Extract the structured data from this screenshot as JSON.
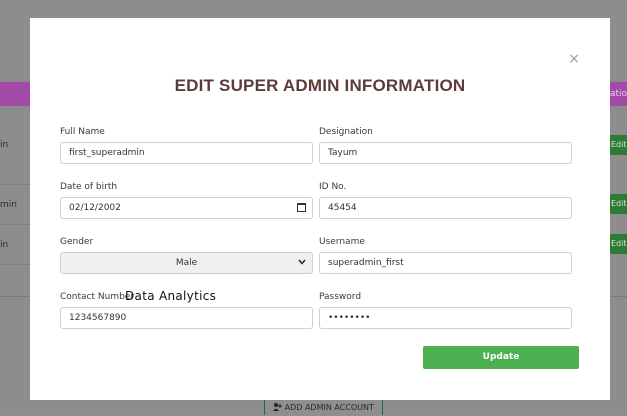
{
  "background": {
    "header_right_text": "ation",
    "rows": [
      {
        "left_text": "in",
        "action": "Edit"
      },
      {
        "left_text": "min",
        "action": "Edit"
      },
      {
        "left_text": "in",
        "action": "Edit"
      }
    ],
    "add_button_label": "ADD ADMIN ACCOUNT",
    "add_button_icon": "add-user-icon",
    "accent_purple": "#a24aa7",
    "accent_green": "#2d7a39"
  },
  "modal": {
    "title": "EDIT SUPER ADMIN INFORMATION",
    "close_icon": "×",
    "fields": {
      "full_name": {
        "label": "Full Name",
        "value": "first_superadmin"
      },
      "designation": {
        "label": "Designation",
        "value": "Tayum"
      },
      "dob": {
        "label": "Date of birth",
        "value": "02/12/2002"
      },
      "id_no": {
        "label": "ID No.",
        "value": "45454"
      },
      "gender": {
        "label": "Gender",
        "value": "Male"
      },
      "username": {
        "label": "Username",
        "value": "superadmin_first"
      },
      "contact": {
        "label": "Contact Number",
        "value": "1234567890"
      },
      "password": {
        "label": "Password",
        "value": "••••••••"
      }
    },
    "overlay_text": "Data Analytics",
    "update_label": "Update",
    "update_color": "#4caf50"
  }
}
